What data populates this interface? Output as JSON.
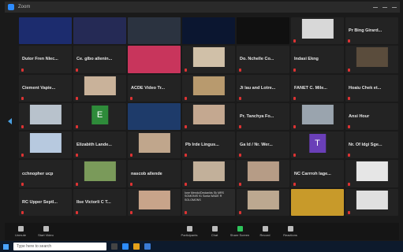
{
  "window": {
    "title": "Zoom"
  },
  "tiles": [
    {
      "kind": "video",
      "bg": "#1c2c6e"
    },
    {
      "kind": "video",
      "bg": "#252a55"
    },
    {
      "kind": "video",
      "bg": "#2b3340"
    },
    {
      "kind": "video",
      "bg": "#0b1630"
    },
    {
      "kind": "video",
      "bg": "#101010"
    },
    {
      "kind": "photo",
      "bg": "#d8d8d8"
    },
    {
      "kind": "name",
      "name": "Pr Bing Girard...",
      "mic": true
    },
    {
      "kind": "name",
      "name": "Dutor Fren Nlec...",
      "mic": true
    },
    {
      "kind": "name",
      "name": "Ce. glbo allenin...",
      "mic": true
    },
    {
      "kind": "video",
      "bg": "#c8355c"
    },
    {
      "kind": "photo",
      "bg": "#d0c0a8"
    },
    {
      "kind": "name",
      "name": "Do. Nchelle Co...",
      "mic": true
    },
    {
      "kind": "name",
      "name": "Indasi Ekng",
      "mic": true
    },
    {
      "kind": "photo",
      "bg": "#5a4c3c"
    },
    {
      "kind": "name",
      "name": "Ciement Vapie...",
      "mic": true
    },
    {
      "kind": "photo",
      "bg": "#c9b29a"
    },
    {
      "kind": "name",
      "name": "ACDE Video Tr...",
      "mic": true
    },
    {
      "kind": "photo",
      "bg": "#b89a6e"
    },
    {
      "kind": "name",
      "name": "Ji lau and Lotre...",
      "mic": true
    },
    {
      "kind": "name",
      "name": "FANET C. Mile...",
      "mic": true
    },
    {
      "kind": "name",
      "name": "Hoaiu Chek et...",
      "mic": true
    },
    {
      "kind": "photo",
      "bg": "#b8c2cc"
    },
    {
      "kind": "letter",
      "letter": "E",
      "bg": "#2e8b3a"
    },
    {
      "kind": "video",
      "bg": "#1e3b6a"
    },
    {
      "kind": "photo",
      "bg": "#c4a890"
    },
    {
      "kind": "name",
      "name": "Pr. Tanchya Fo...",
      "mic": true
    },
    {
      "kind": "photo",
      "bg": "#9aa4ae"
    },
    {
      "kind": "name",
      "name": "Ansi Hour",
      "mic": true
    },
    {
      "kind": "photo",
      "bg": "#b7c9df"
    },
    {
      "kind": "name",
      "name": "Elizabith Lande...",
      "mic": true
    },
    {
      "kind": "photo",
      "bg": "#c0a68c"
    },
    {
      "kind": "name",
      "name": "Pb Irde Lingus...",
      "mic": true
    },
    {
      "kind": "name",
      "name": "Ga ld / Nr. Wer...",
      "mic": true
    },
    {
      "kind": "letter",
      "letter": "T",
      "bg": "#6a3fb8"
    },
    {
      "kind": "name",
      "name": "Nr. Of ldgi Sge...",
      "mic": true
    },
    {
      "kind": "name",
      "name": "cchnopher ucp",
      "mic": true
    },
    {
      "kind": "photo",
      "bg": "#7a9a5a"
    },
    {
      "kind": "name",
      "name": "nascob allende",
      "mic": true
    },
    {
      "kind": "photo",
      "bg": "#c2b09a"
    },
    {
      "kind": "photo",
      "bg": "#b69c86"
    },
    {
      "kind": "name",
      "name": "NC Carrroh lage...",
      "mic": true
    },
    {
      "kind": "photo",
      "bg": "#e6e6e6"
    },
    {
      "kind": "name",
      "name": "RC Upper Septl...",
      "mic": true
    },
    {
      "kind": "name",
      "name": "Ilse Victorli C T...",
      "mic": true
    },
    {
      "kind": "photo",
      "bg": "#c8a48a"
    },
    {
      "kind": "chat",
      "text": "Ione Mendu/Decianlds Sk MRS SOMONIS 91 Sonia WADE R SOLOMONS"
    },
    {
      "kind": "photo",
      "bg": "#bca890"
    },
    {
      "kind": "video",
      "bg": "#c89a2a"
    },
    {
      "kind": "photo",
      "bg": "#e0e0e0"
    }
  ],
  "toolbar": {
    "left": [
      "Unmute",
      "Start Video"
    ],
    "mid": [
      "Participants",
      "Chat",
      "Share Screen",
      "Record",
      "Reactions"
    ]
  },
  "taskbar": {
    "search_placeholder": "Type here to search"
  }
}
